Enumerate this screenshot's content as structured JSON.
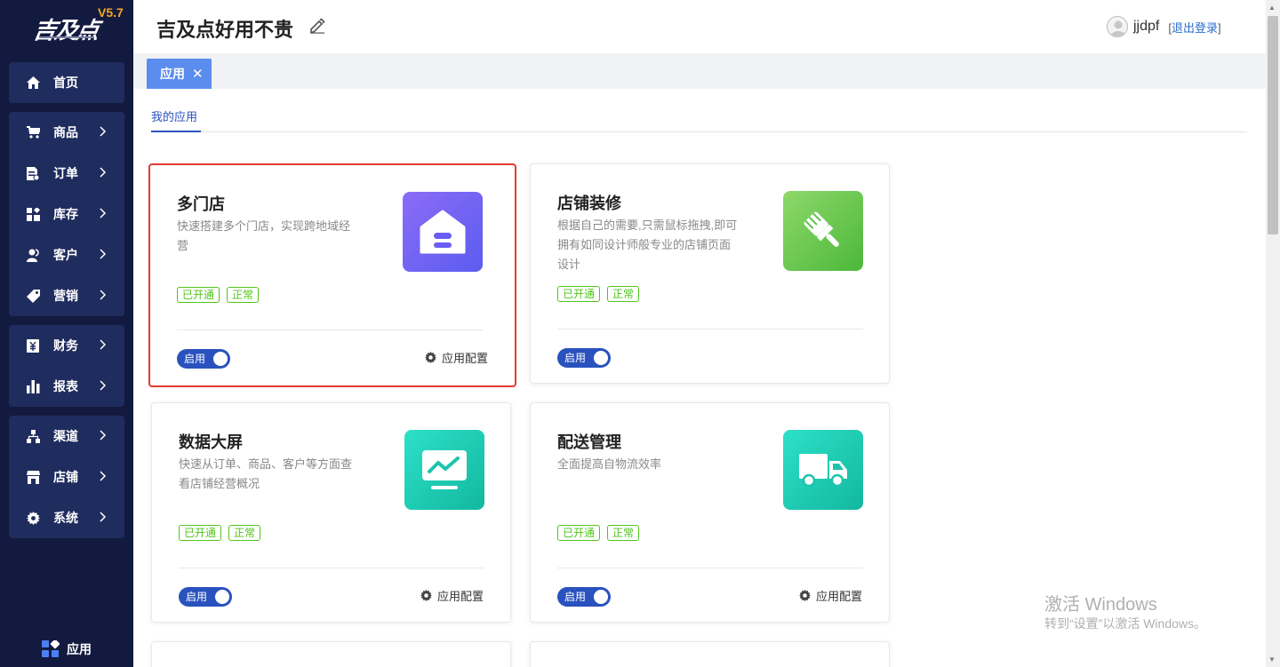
{
  "brand": {
    "logo_text": "吉及点",
    "version": "V5.7"
  },
  "sidebar": {
    "groups": [
      [
        {
          "label": "首页",
          "icon": "home-icon"
        }
      ],
      [
        {
          "label": "商品",
          "icon": "cart-icon"
        },
        {
          "label": "订单",
          "icon": "order-icon"
        },
        {
          "label": "库存",
          "icon": "inventory-icon"
        },
        {
          "label": "客户",
          "icon": "customer-icon"
        },
        {
          "label": "营销",
          "icon": "tag-icon"
        }
      ],
      [
        {
          "label": "财务",
          "icon": "finance-icon"
        },
        {
          "label": "报表",
          "icon": "report-icon"
        }
      ],
      [
        {
          "label": "渠道",
          "icon": "channel-icon"
        },
        {
          "label": "店铺",
          "icon": "store-icon"
        },
        {
          "label": "系统",
          "icon": "settings-icon"
        }
      ]
    ],
    "app_entry": {
      "label": "应用",
      "icon": "apps-icon"
    }
  },
  "header": {
    "title": "吉及点好用不贵",
    "username": "jjdpf",
    "logout_prefix": "[",
    "logout_label": "退出登录",
    "logout_suffix": "]"
  },
  "tabs": [
    {
      "label": "应用",
      "close": "✕"
    }
  ],
  "content": {
    "subtab": "我的应用",
    "cards": [
      {
        "title": "多门店",
        "desc": "快速搭建多个门店，实现跨地域经营",
        "tags": [
          "已开通",
          "正常"
        ],
        "toggle": "启用",
        "config": "应用配置",
        "icon": "store-house-icon",
        "color_from": "#8b6cf6",
        "color_to": "#5b5cf0",
        "selected": true
      },
      {
        "title": "店铺装修",
        "desc": "根据自己的需要,只需鼠标拖拽,即可拥有如同设计师般专业的店铺页面设计",
        "tags": [
          "已开通",
          "正常"
        ],
        "toggle": "启用",
        "config": "应用配置",
        "icon": "paint-brush-icon",
        "color_from": "#8ed86a",
        "color_to": "#4cb83a",
        "selected": false
      },
      {
        "title": "数据大屏",
        "desc": "快速从订单、商品、客户等方面查看店铺经营概况",
        "tags": [
          "已开通",
          "正常"
        ],
        "toggle": "启用",
        "config": "应用配置",
        "icon": "monitor-chart-icon",
        "color_from": "#2ee0c8",
        "color_to": "#12b8a0",
        "selected": false
      },
      {
        "title": "配送管理",
        "desc": "全面提高自物流效率",
        "tags": [
          "已开通",
          "正常"
        ],
        "toggle": "启用",
        "config": "应用配置",
        "icon": "truck-icon",
        "color_from": "#2ee0c8",
        "color_to": "#12b8a0",
        "selected": false
      }
    ]
  },
  "watermark": {
    "line1": "激活 Windows",
    "line2": "转到“设置”以激活 Windows。"
  }
}
